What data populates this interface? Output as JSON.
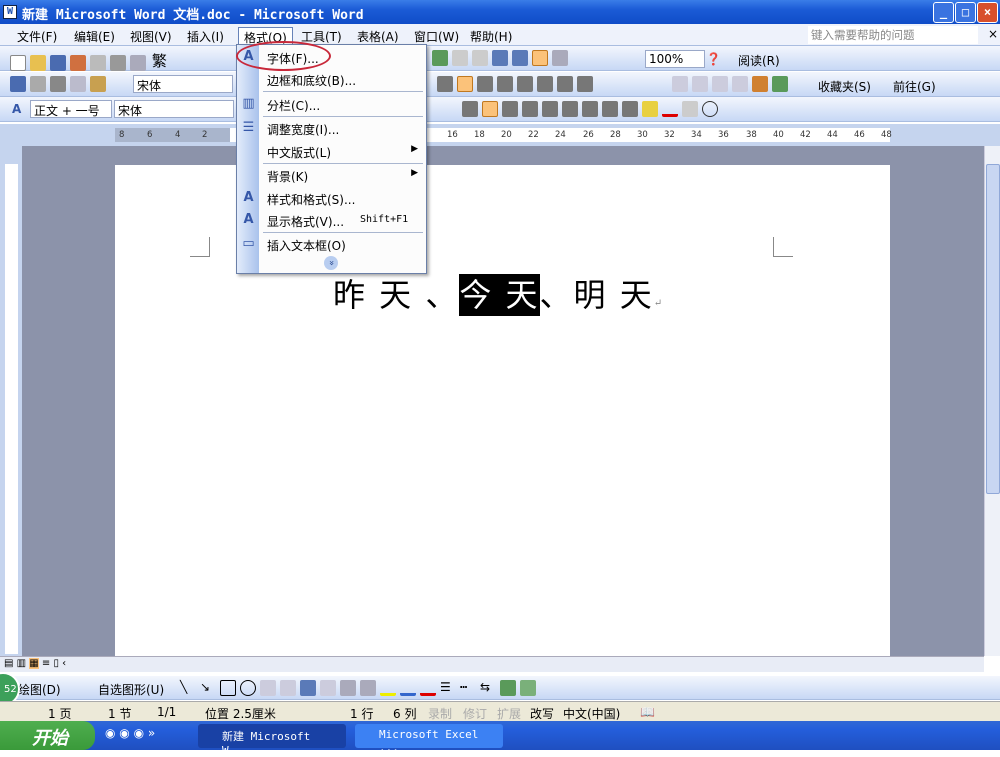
{
  "window": {
    "title": "新建 Microsoft Word 文档.doc - Microsoft Word",
    "min": "_",
    "max": "□",
    "close": "×"
  },
  "menubar": {
    "items": [
      "文件(F)",
      "编辑(E)",
      "视图(V)",
      "插入(I)",
      "格式(O)",
      "工具(T)",
      "表格(A)",
      "窗口(W)",
      "帮助(H)"
    ],
    "help_placeholder": "键入需要帮助的问题",
    "help_close": "×"
  },
  "toolbar": {
    "zoom": "100%",
    "read": "阅读(R)",
    "trad": "繁",
    "font_name": "宋体",
    "style": "正文 + 一号",
    "style_font": "宋体",
    "favorites": "收藏夹(S)",
    "goto": "前往(G)"
  },
  "ruler": {
    "left_numbers": [
      "8",
      "6",
      "4",
      "2"
    ],
    "right_numbers": [
      "16",
      "18",
      "20",
      "22",
      "24",
      "26",
      "28",
      "30",
      "32",
      "34",
      "36",
      "38",
      "40",
      "42",
      "44",
      "46",
      "48"
    ]
  },
  "document": {
    "before": "昨 天 、",
    "selected": "今 天",
    "after": "、明 天"
  },
  "format_menu": {
    "items": [
      {
        "label": "字体(F)...",
        "icon": "font-A-icon"
      },
      {
        "label": "边框和底纹(B)..."
      },
      {
        "label": "分栏(C)...",
        "icon": "columns-icon"
      },
      {
        "label": "调整宽度(I)...",
        "icon": "fit-width-icon"
      },
      {
        "label": "中文版式(L)",
        "submenu": true
      },
      {
        "label": "背景(K)",
        "submenu": true
      },
      {
        "label": "样式和格式(S)...",
        "icon": "styles-icon"
      },
      {
        "label": "显示格式(V)...",
        "shortcut": "Shift+F1",
        "icon": "reveal-format-icon"
      },
      {
        "label": "插入文本框(O)",
        "icon": "textbox-icon"
      }
    ],
    "expand": "»"
  },
  "drawing": {
    "draw": "绘图(D)",
    "autoshapes": "自选图形(U)"
  },
  "status": {
    "page": "1 页",
    "section": "1 节",
    "pages": "1/1",
    "position": "位置 2.5厘米",
    "line": "1 行",
    "col": "6 列",
    "rec": "录制",
    "trk": "修订",
    "ext": "扩展",
    "ovr": "改写",
    "lang": "中文(中国)"
  },
  "taskbar": {
    "start": "开始",
    "tasks": [
      "新建 Microsoft W...",
      "Microsoft Excel ..."
    ],
    "badge": "52"
  }
}
